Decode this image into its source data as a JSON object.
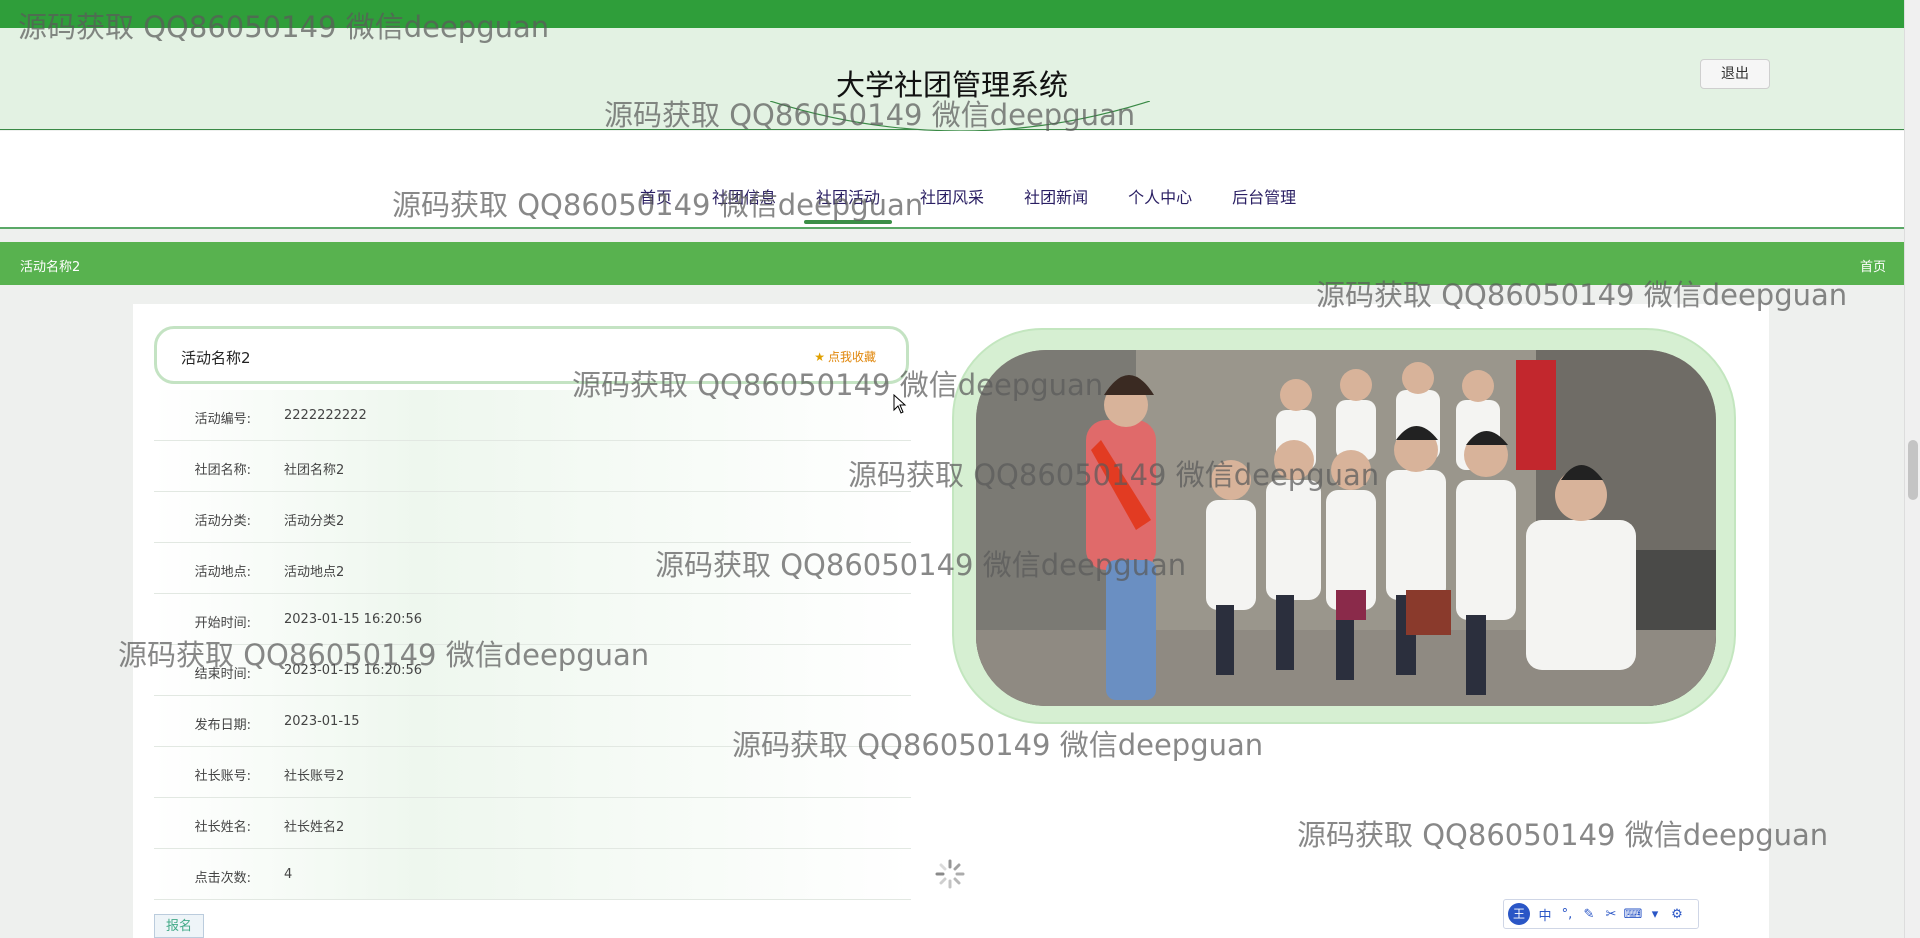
{
  "app": {
    "title": "大学社团管理系统",
    "logout_label": "退出"
  },
  "nav": {
    "items": [
      {
        "label": "首页"
      },
      {
        "label": "社团信息"
      },
      {
        "label": "社团活动"
      },
      {
        "label": "社团风采"
      },
      {
        "label": "社团新闻"
      },
      {
        "label": "个人中心"
      },
      {
        "label": "后台管理"
      }
    ],
    "active_index": 2
  },
  "breadcrumb": {
    "current": "活动名称2",
    "home_label": "首页"
  },
  "activity": {
    "title": "活动名称2",
    "favorite_label": "点我收藏",
    "fields": [
      {
        "label": "活动编号:",
        "value": "2222222222"
      },
      {
        "label": "社团名称:",
        "value": "社团名称2"
      },
      {
        "label": "活动分类:",
        "value": "活动分类2"
      },
      {
        "label": "活动地点:",
        "value": "活动地点2"
      },
      {
        "label": "开始时间:",
        "value": "2023-01-15 16:20:56"
      },
      {
        "label": "结束时间:",
        "value": "2023-01-15 16:20:56"
      },
      {
        "label": "发布日期:",
        "value": "2023-01-15"
      },
      {
        "label": "社长账号:",
        "value": "社长账号2"
      },
      {
        "label": "社长姓名:",
        "value": "社长姓名2"
      },
      {
        "label": "点击次数:",
        "value": "4"
      }
    ],
    "signup_label": "报名"
  },
  "ime_toolbar": {
    "logo": "王",
    "mode": "中"
  },
  "watermarks": [
    "源码获取 QQ86050149 微信deepguan",
    "源码获取 QQ86050149 微信deepguan",
    "源码获取 QQ86050149 微信deepguan",
    "源码获取 QQ86050149 微信deepguan",
    "源码获取 QQ86050149 微信deepguan",
    "源码获取 QQ86050149 微信deepguan",
    "源码获取 QQ86050149 微信deepguan",
    "源码获取 QQ86050149 微信deepguan",
    "源码获取 QQ86050149 微信deepguan",
    "源码获取 QQ86050149 微信deepguan"
  ],
  "colors": {
    "brand_green": "#2f9e3a",
    "crumb_green": "#58b24f",
    "header_bg": "#e3f2e3",
    "fav_orange": "#e0860a"
  }
}
